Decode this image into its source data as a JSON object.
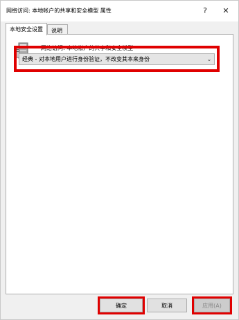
{
  "window": {
    "title": "网络访问: 本地帐户的共享和安全模型 属性",
    "help_label": "?",
    "close_label": "✕"
  },
  "tabs": [
    {
      "label": "本地安全设置",
      "active": true
    },
    {
      "label": "说明",
      "active": false
    }
  ],
  "policy": {
    "name": "网络访问: 本地帐户的共享和安全模型",
    "icon": "policy-server-icon"
  },
  "dropdown": {
    "selected": "经典 - 对本地用户进行身份验证，不改变其本来身份",
    "chevron": "⌄"
  },
  "buttons": {
    "ok": "确定",
    "cancel": "取消",
    "apply": "应用(A)",
    "apply_enabled": false
  },
  "colors": {
    "highlight": "#e00000",
    "window_bg": "#f0f0f0",
    "panel_bg": "#ffffff"
  }
}
